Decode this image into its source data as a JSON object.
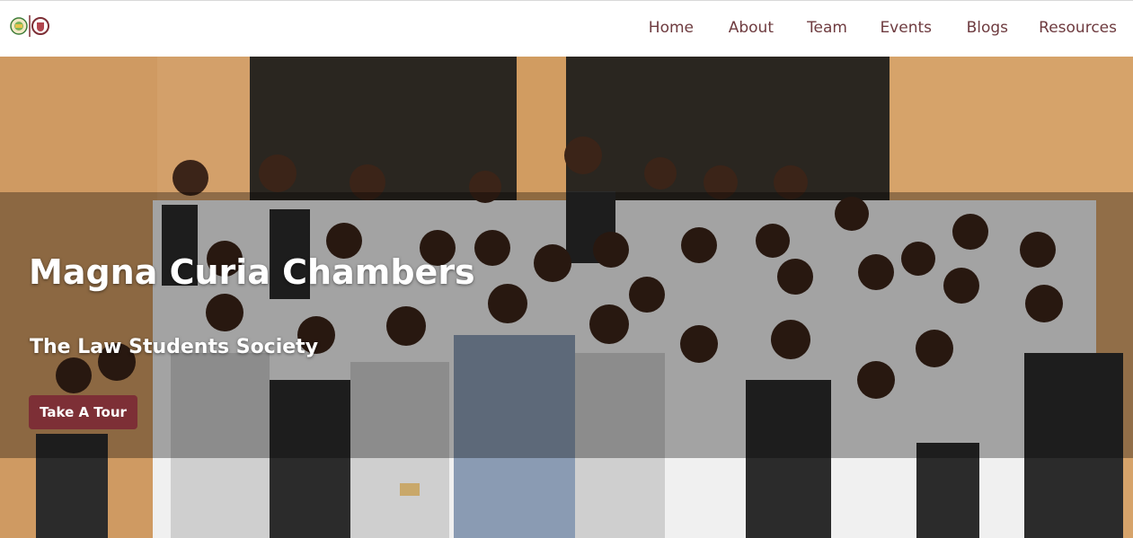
{
  "nav": {
    "logo_alt": "Magna Curia Chambers logo",
    "links": [
      {
        "label": "Home"
      },
      {
        "label": "About"
      },
      {
        "label": "Team"
      },
      {
        "label": "Events"
      },
      {
        "label": "Blogs"
      },
      {
        "label": "Resources"
      }
    ],
    "link_color": "#6e3b3f"
  },
  "hero": {
    "title": "Magna Curia Chambers",
    "subtitle": "The Law Students Society",
    "cta_label": "Take A Tour",
    "cta_color": "#7d2f36",
    "image_description_name": "group-photo"
  }
}
